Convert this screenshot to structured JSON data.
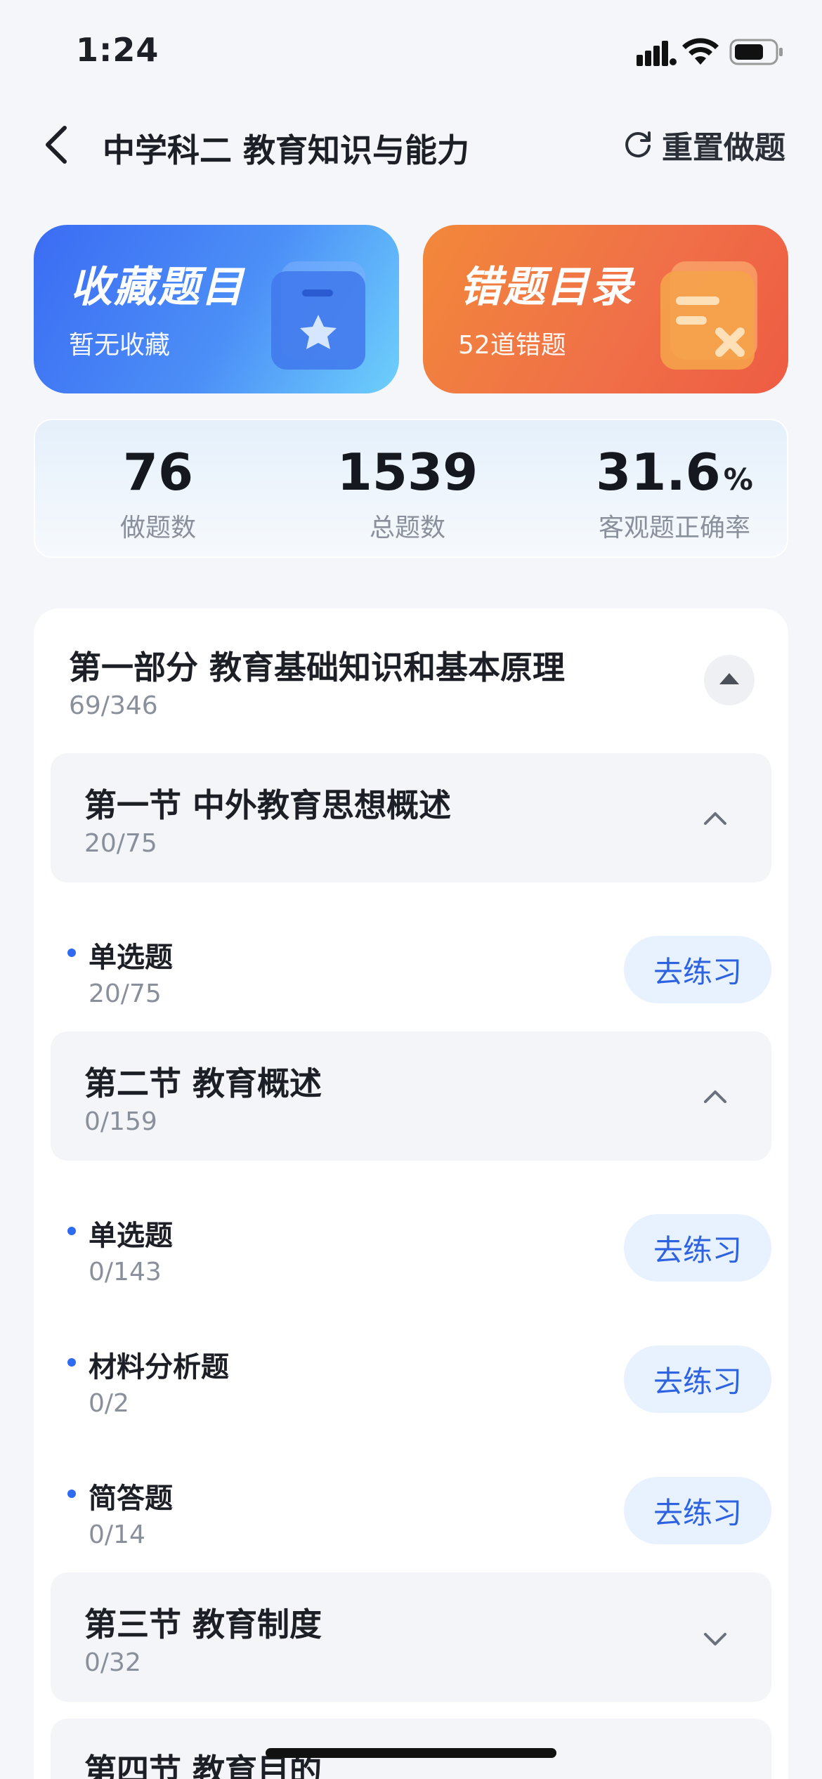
{
  "status_bar": {
    "time": "1:24"
  },
  "header": {
    "back_label": "back",
    "title": "中学科二 教育知识与能力",
    "reset_label": "重置做题"
  },
  "cards": {
    "favorites": {
      "title": "收藏题目",
      "subtitle": "暂无收藏"
    },
    "wrong": {
      "title": "错题目录",
      "subtitle": "52道错题"
    }
  },
  "stats": [
    {
      "value": "76",
      "unit": "",
      "label": "做题数"
    },
    {
      "value": "1539",
      "unit": "",
      "label": "总题数"
    },
    {
      "value": "31.6",
      "unit": "%",
      "label": "客观题正确率"
    }
  ],
  "part": {
    "title": "第一部分 教育基础知识和基本原理",
    "count": "69/346"
  },
  "chapters": [
    {
      "title": "第一节 中外教育思想概述",
      "count": "20/75",
      "expanded": true,
      "types": [
        {
          "name": "单选题",
          "count": "20/75",
          "button": "去练习"
        }
      ]
    },
    {
      "title": "第二节 教育概述",
      "count": "0/159",
      "expanded": true,
      "types": [
        {
          "name": "单选题",
          "count": "0/143",
          "button": "去练习"
        },
        {
          "name": "材料分析题",
          "count": "0/2",
          "button": "去练习"
        },
        {
          "name": "简答题",
          "count": "0/14",
          "button": "去练习"
        }
      ]
    },
    {
      "title": "第三节 教育制度",
      "count": "0/32",
      "expanded": false,
      "types": []
    },
    {
      "title": "第四节 教育目的",
      "count": "",
      "expanded": false,
      "types": []
    }
  ],
  "colors": {
    "accent": "#2f6bf0",
    "fav_card": "#4c8ff7",
    "wrong_card": "#f07048"
  }
}
